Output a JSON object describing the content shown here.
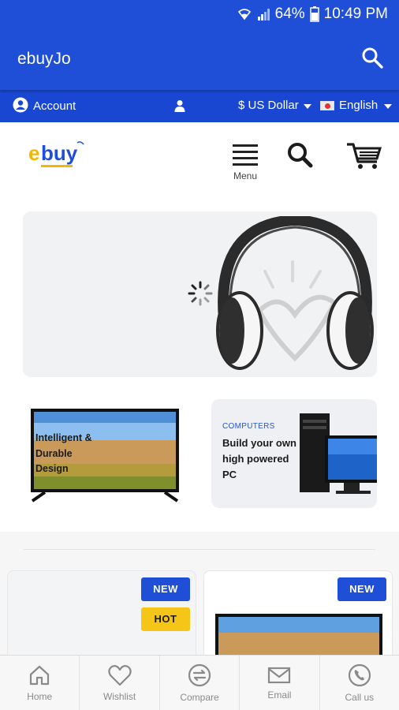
{
  "status_bar": {
    "battery": "64%",
    "time": "10:49 PM"
  },
  "app_bar": {
    "title": "ebuyJo",
    "search_icon": "search-icon"
  },
  "top_bar": {
    "account_label": "Account",
    "currency": "$ US Dollar",
    "language": "English"
  },
  "header": {
    "logo_text": "ebuy",
    "menu_label": "Menu"
  },
  "promos": {
    "tv_text": [
      "Intelligent &",
      "Durable",
      "Design"
    ],
    "pc_category": "COMPUTERS",
    "pc_headline": [
      "Build your own",
      "high powered",
      "PC"
    ]
  },
  "products": {
    "badges": {
      "new": "NEW",
      "hot": "HOT"
    }
  },
  "bottom_nav": {
    "items": [
      {
        "label": "Home",
        "icon": "home-icon"
      },
      {
        "label": "Wishlist",
        "icon": "heart-icon"
      },
      {
        "label": "Compare",
        "icon": "compare-icon"
      },
      {
        "label": "Email",
        "icon": "mail-icon"
      },
      {
        "label": "Call us",
        "icon": "phone-icon"
      }
    ]
  },
  "colors": {
    "primary": "#1f4fd6",
    "hot": "#f5c518"
  }
}
